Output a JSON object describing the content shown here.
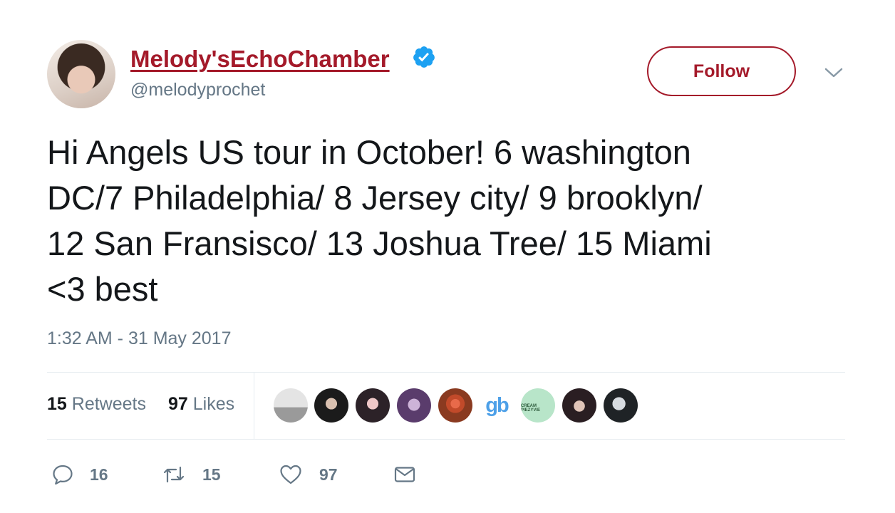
{
  "user": {
    "display_name": "Melody'sEchoChamber",
    "handle": "@melodyprochet",
    "verified": true,
    "avatar_icon": "profile-photo"
  },
  "follow_label": "Follow",
  "tweet": {
    "text": "Hi Angels US tour in October! 6 washington\nDC/7 Philadelphia/ 8 Jersey city/ 9 brooklyn/\n12 San Fransisco/ 13 Joshua Tree/ 15 Miami\n<3 best",
    "timestamp": "1:32 AM - 31 May 2017"
  },
  "stats": {
    "retweets_count": "15",
    "retweets_label": "Retweets",
    "likes_count": "97",
    "likes_label": "Likes"
  },
  "likers": {
    "gb_text": "gb",
    "ice_text": "CREAM PIEZYVIE"
  },
  "actions": {
    "reply_count": "16",
    "retweet_count": "15",
    "like_count": "97"
  },
  "colors": {
    "brand_link": "#a41a2a",
    "verified_blue": "#1da1f2",
    "secondary_text": "#657786"
  }
}
